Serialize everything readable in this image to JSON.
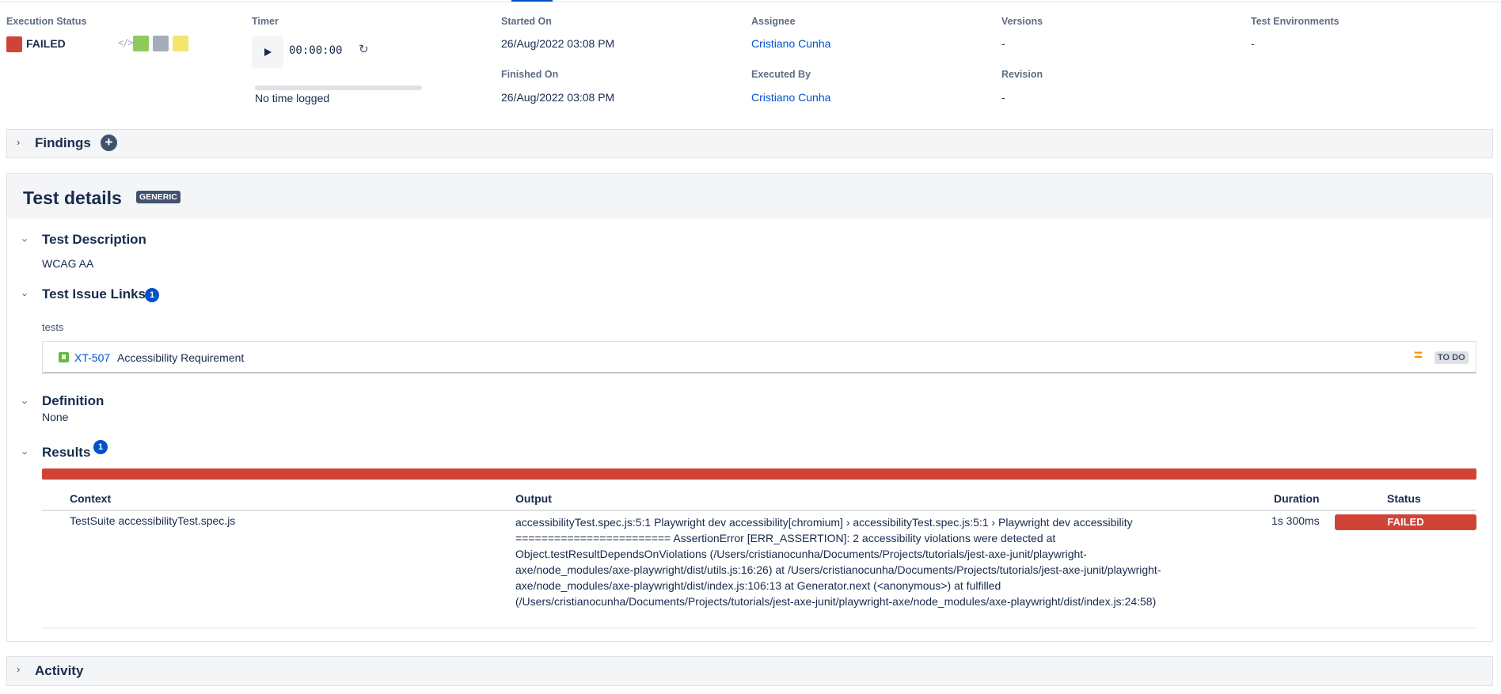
{
  "header": {
    "execution_status": {
      "label": "Execution Status",
      "value": "FAILED",
      "status_color": "#d04437",
      "code_icon": "</>",
      "quick_status_colors": [
        "#8fca5d",
        "#a5adba",
        "#f5e56b"
      ]
    },
    "timer": {
      "label": "Timer",
      "value": "00:00:00",
      "progress": 0,
      "no_time_text": "No time logged"
    },
    "started_on": {
      "label": "Started On",
      "value": "26/Aug/2022 03:08 PM"
    },
    "finished_on": {
      "label": "Finished On",
      "value": "26/Aug/2022 03:08 PM"
    },
    "assignee": {
      "label": "Assignee",
      "value": "Cristiano Cunha"
    },
    "executed_by": {
      "label": "Executed By",
      "value": "Cristiano Cunha"
    },
    "versions": {
      "label": "Versions",
      "value": "-"
    },
    "revision": {
      "label": "Revision",
      "value": "-"
    },
    "test_environments": {
      "label": "Test Environments",
      "value": "-"
    }
  },
  "findings": {
    "title": "Findings"
  },
  "test_details": {
    "title": "Test details",
    "type_badge": "GENERIC",
    "description": {
      "title": "Test Description",
      "text": "WCAG AA"
    },
    "issue_links": {
      "title": "Test Issue Links",
      "count": "1",
      "relation": "tests",
      "items": [
        {
          "key": "XT-507",
          "summary": "Accessibility Requirement",
          "priority_icon": "=",
          "status": "TO DO"
        }
      ]
    },
    "definition": {
      "title": "Definition",
      "text": "None"
    },
    "results": {
      "title": "Results",
      "count": "1",
      "bar_color": "#d04437",
      "columns": [
        "Context",
        "Output",
        "Duration",
        "Status"
      ],
      "rows": [
        {
          "context": "TestSuite accessibilityTest.spec.js",
          "output": "accessibilityTest.spec.js:5:1 Playwright dev accessibility[chromium] › accessibilityTest.spec.js:5:1 › Playwright dev accessibility ======================== AssertionError [ERR_ASSERTION]: 2 accessibility violations were detected at Object.testResultDependsOnViolations (/Users/cristianocunha/Documents/Projects/tutorials/jest-axe-junit/playwright-axe/node_modules/axe-playwright/dist/utils.js:16:26) at /Users/cristianocunha/Documents/Projects/tutorials/jest-axe-junit/playwright-axe/node_modules/axe-playwright/dist/index.js:106:13 at Generator.next (<anonymous>) at fulfilled (/Users/cristianocunha/Documents/Projects/tutorials/jest-axe-junit/playwright-axe/node_modules/axe-playwright/dist/index.js:24:58)",
          "duration": "1s 300ms",
          "status": "FAILED"
        }
      ]
    }
  },
  "activity": {
    "title": "Activity"
  }
}
